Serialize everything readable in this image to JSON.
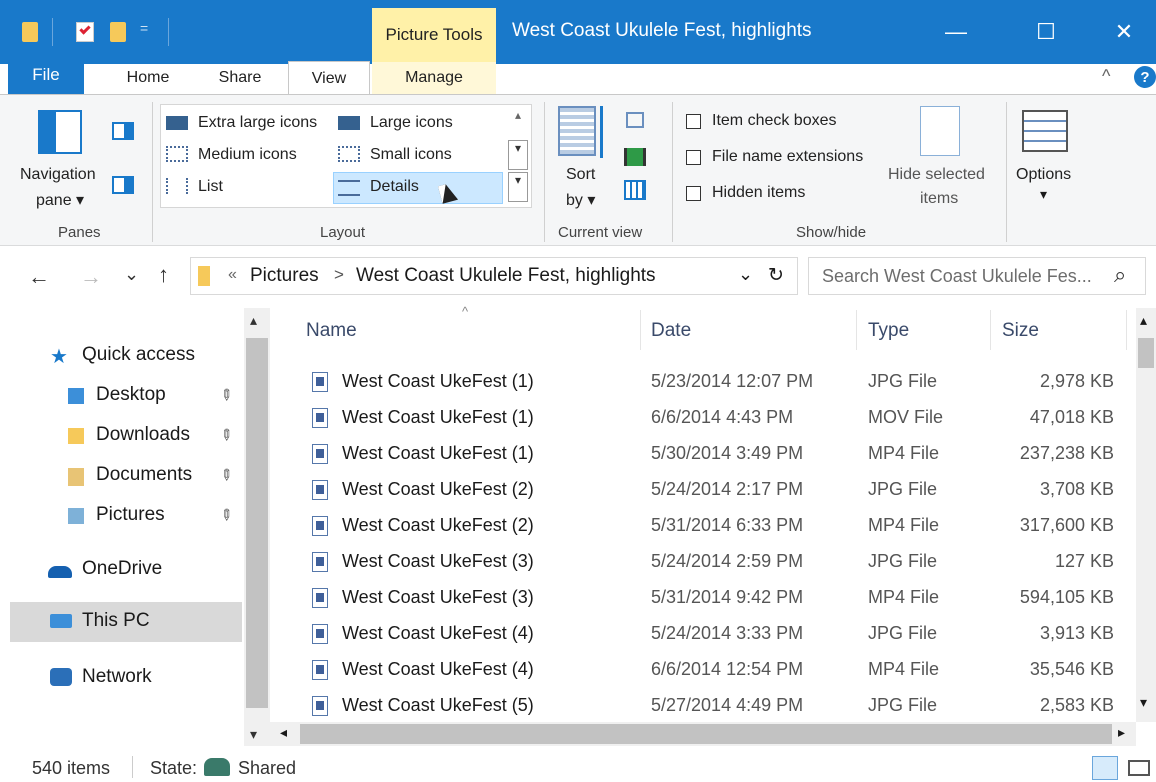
{
  "qat": {
    "dropdown": "="
  },
  "title_bar": {
    "context_group": "Picture Tools",
    "title": "West Coast Ukulele Fest, highlights",
    "minimize": "—",
    "maximize": "☐",
    "close": "✕"
  },
  "tabs": {
    "file": "File",
    "home": "Home",
    "share": "Share",
    "view": "View",
    "manage": "Manage",
    "collapse": "^",
    "help": "?"
  },
  "ribbon": {
    "panes": {
      "navigation_label_1": "Navigation",
      "navigation_label_2": "pane ▾",
      "group_label": "Panes"
    },
    "layout": {
      "extra_large": "Extra large icons",
      "large": "Large icons",
      "medium": "Medium icons",
      "small": "Small icons",
      "list": "List",
      "details": "Details",
      "group_label": "Layout"
    },
    "current_view": {
      "sort_1": "Sort",
      "sort_2": "by ▾",
      "group_label": "Current view"
    },
    "show_hide": {
      "item_check": "Item check boxes",
      "file_ext": "File name extensions",
      "hidden": "Hidden items",
      "hide_selected_1": "Hide selected",
      "hide_selected_2": "items",
      "group_label": "Show/hide"
    },
    "options": {
      "label": "Options",
      "arrow": "▾"
    }
  },
  "address": {
    "overflow": "«",
    "crumb1": "Pictures",
    "sep": ">",
    "crumb2": "West Coast Ukulele Fest, highlights",
    "dropdown": "⌄",
    "refresh": "↻"
  },
  "search": {
    "placeholder": "Search West Coast Ukulele Fes...",
    "icon": "⌕"
  },
  "nav": {
    "back": "←",
    "forward": "→",
    "recent": "⌄",
    "up": "↑"
  },
  "sidebar": {
    "quick_access": "Quick access",
    "desktop": "Desktop",
    "downloads": "Downloads",
    "documents": "Documents",
    "pictures": "Pictures",
    "onedrive": "OneDrive",
    "this_pc": "This PC",
    "network": "Network",
    "pin": "📌"
  },
  "columns": {
    "name": "Name",
    "date": "Date",
    "type": "Type",
    "size": "Size",
    "sort_arrow": "^"
  },
  "files": [
    {
      "name": "West Coast UkeFest (1)",
      "date": "5/23/2014 12:07 PM",
      "type": "JPG File",
      "size": "2,978 KB"
    },
    {
      "name": "West Coast UkeFest (1)",
      "date": "6/6/2014 4:43 PM",
      "type": "MOV File",
      "size": "47,018 KB"
    },
    {
      "name": "West Coast UkeFest (1)",
      "date": "5/30/2014 3:49 PM",
      "type": "MP4 File",
      "size": "237,238 KB"
    },
    {
      "name": "West Coast UkeFest (2)",
      "date": "5/24/2014 2:17 PM",
      "type": "JPG File",
      "size": "3,708 KB"
    },
    {
      "name": "West Coast UkeFest (2)",
      "date": "5/31/2014 6:33 PM",
      "type": "MP4 File",
      "size": "317,600 KB"
    },
    {
      "name": "West Coast UkeFest (3)",
      "date": "5/24/2014 2:59 PM",
      "type": "JPG File",
      "size": "127 KB"
    },
    {
      "name": "West Coast UkeFest (3)",
      "date": "5/31/2014 9:42 PM",
      "type": "MP4 File",
      "size": "594,105 KB"
    },
    {
      "name": "West Coast UkeFest (4)",
      "date": "5/24/2014 3:33 PM",
      "type": "JPG File",
      "size": "3,913 KB"
    },
    {
      "name": "West Coast UkeFest (4)",
      "date": "6/6/2014 12:54 PM",
      "type": "MP4 File",
      "size": "35,546 KB"
    },
    {
      "name": "West Coast UkeFest (5)",
      "date": "5/27/2014 4:49 PM",
      "type": "JPG File",
      "size": "2,583 KB"
    }
  ],
  "status": {
    "items": "540 items",
    "state_label": "State:",
    "state_value": "Shared"
  },
  "colors": {
    "accent": "#1979ca",
    "context_tab": "#fff1a8",
    "selection": "#cce8ff"
  }
}
